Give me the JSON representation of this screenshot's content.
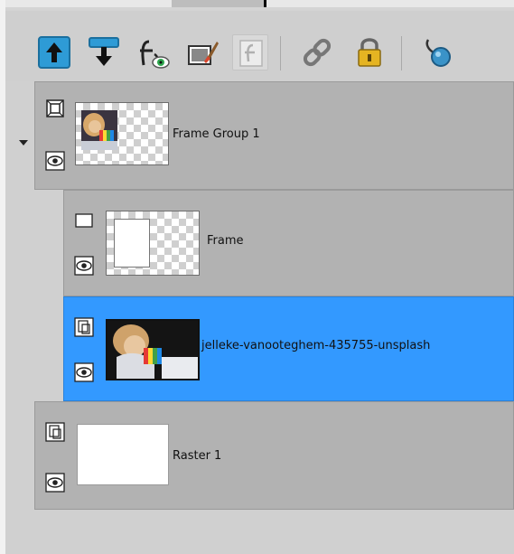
{
  "toolbar": {
    "buttons": [
      {
        "id": "move-up",
        "icon": "arrow-up-icon",
        "enabled": true
      },
      {
        "id": "move-down",
        "icon": "arrow-down-icon",
        "enabled": true
      },
      {
        "id": "effects",
        "icon": "fx-eye-icon",
        "enabled": true
      },
      {
        "id": "edit-selection",
        "icon": "paint-brush-icon",
        "enabled": true
      },
      {
        "id": "layer-style",
        "icon": "layer-style-icon",
        "enabled": false
      },
      {
        "id": "link",
        "icon": "chain-link-icon",
        "enabled": true
      },
      {
        "id": "lock",
        "icon": "padlock-icon",
        "enabled": true
      },
      {
        "id": "mask",
        "icon": "mask-pin-icon",
        "enabled": true
      }
    ]
  },
  "layers": {
    "frame_group": {
      "name": "Frame Group 1",
      "type_icon": "frame-group-icon",
      "visible": true,
      "expanded": true
    },
    "frame": {
      "name": "Frame",
      "type_icon": "frame-rect-icon",
      "visible": true
    },
    "photo": {
      "name": "jelleke-vanooteghem-435755-unsplash",
      "type_icon": "raster-layer-icon",
      "visible": true,
      "selected": true
    },
    "raster": {
      "name": "Raster 1",
      "type_icon": "raster-layer-icon",
      "visible": true
    }
  },
  "colors": {
    "selected_row": "#3399ff",
    "row": "#b2b2b2",
    "panel": "#d0d0d0"
  }
}
